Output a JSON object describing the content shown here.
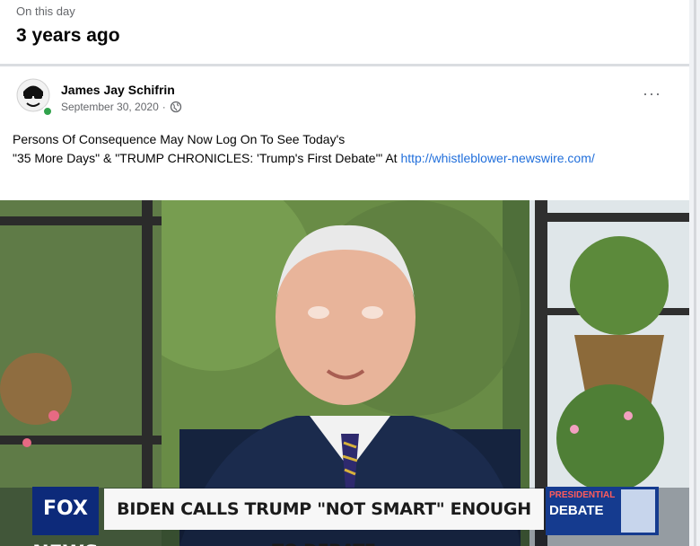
{
  "memory": {
    "kicker": "On this day",
    "title": "3 years ago"
  },
  "post": {
    "author": "James Jay Schifrin",
    "date": "September 30, 2020",
    "privacy_icon": "globe-icon",
    "more_label": "···",
    "text_line1": "Persons Of Consequence May Now Log On To See Today's",
    "text_line2_prefix": "\"35 More Days\" & \"TRUMP CHRONICLES: 'Trump's First Debate'\" At ",
    "link_text": "http://whistleblower-newswire.com/"
  },
  "video": {
    "network_logo": "FOX NEWS",
    "chyron": "BIDEN CALLS TRUMP \"NOT SMART\" ENOUGH TO DEBATE",
    "badge_kicker": "PRESIDENTIAL",
    "badge_word": "DEBATE"
  },
  "colors": {
    "accent_link": "#216fdb",
    "online": "#31a24c",
    "fox_blue": "#0d2a7a"
  }
}
